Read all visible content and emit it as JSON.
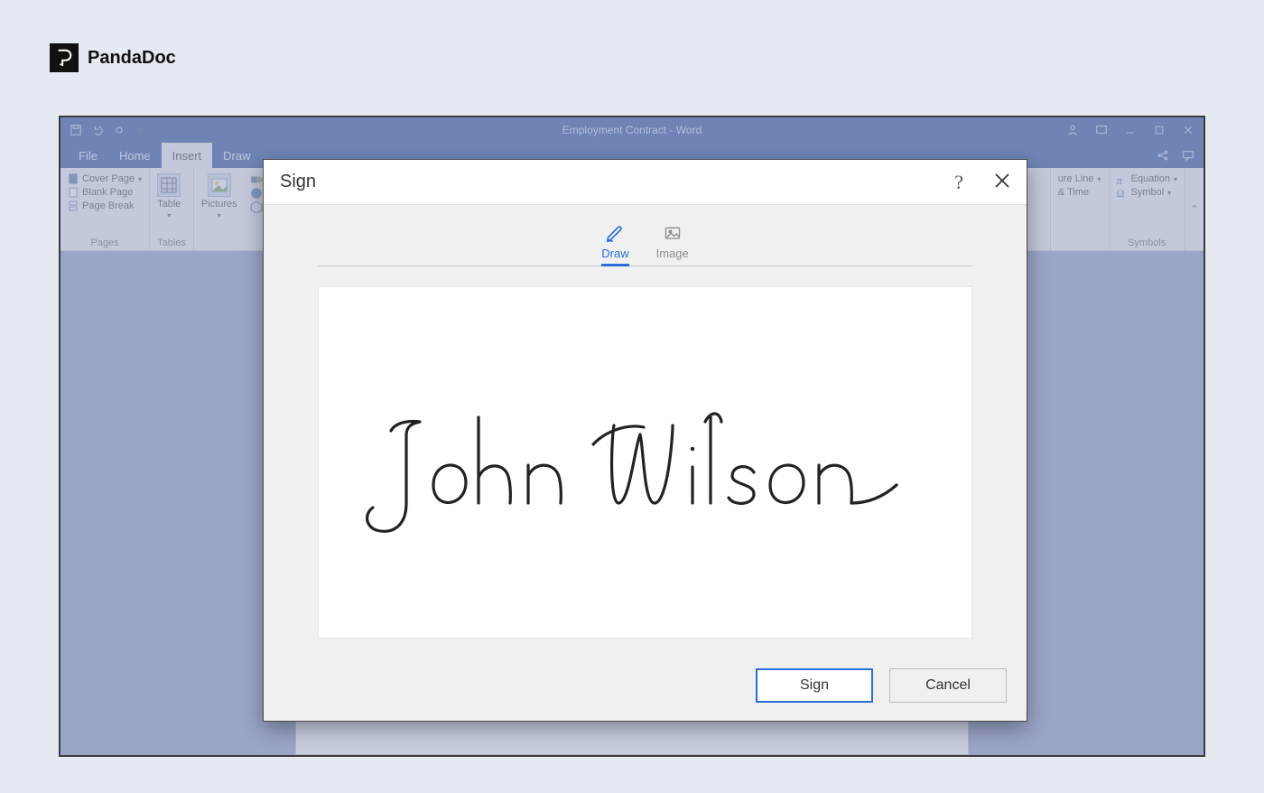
{
  "brand": {
    "name": "PandaDoc"
  },
  "word": {
    "document_title": "Employment Contract - Word",
    "tabs": {
      "file": "File",
      "home": "Home",
      "insert": "Insert",
      "draw": "Draw"
    },
    "ribbon": {
      "pages": {
        "cover_page": "Cover Page",
        "blank_page": "Blank Page",
        "page_break": "Page Break",
        "group_label": "Pages"
      },
      "tables": {
        "table": "Table",
        "group_label": "Tables"
      },
      "illustrations": {
        "pictures": "Pictures"
      },
      "right1": {
        "signature_line": "ure Line",
        "date_time": "& Time"
      },
      "right2": {
        "equation": "Equation",
        "symbol": "Symbol",
        "group_label": "Symbols"
      }
    }
  },
  "dialog": {
    "title": "Sign",
    "tabs": {
      "draw": "Draw",
      "image": "Image"
    },
    "signature_text": "John Wilson",
    "buttons": {
      "sign": "Sign",
      "cancel": "Cancel"
    }
  }
}
